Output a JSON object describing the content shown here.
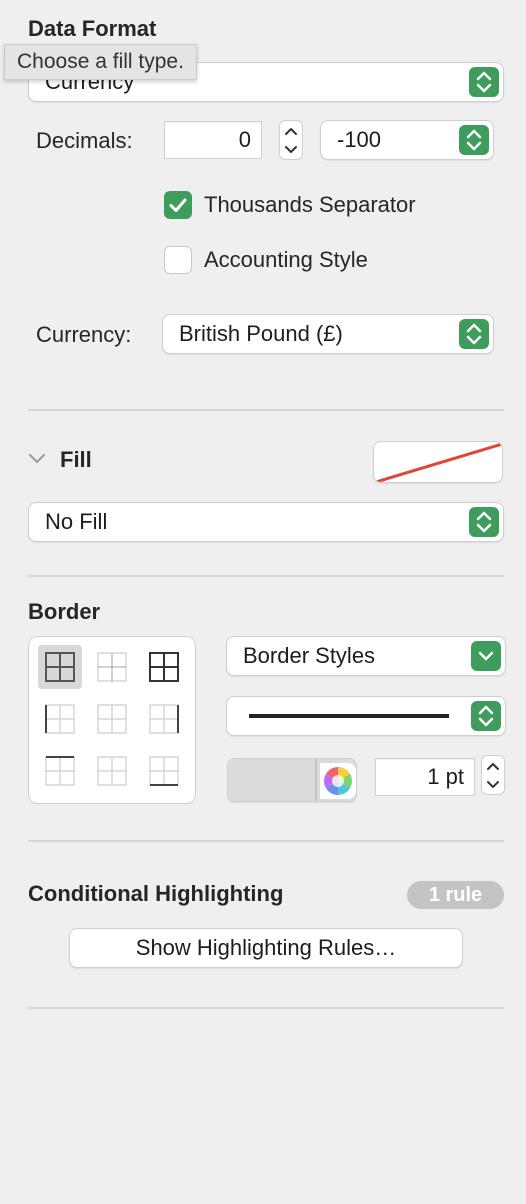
{
  "data_format": {
    "title": "Data Format",
    "format_value": "Currency",
    "decimals_label": "Decimals:",
    "decimals_value": "0",
    "negative_value": "-100",
    "thousands_label": "Thousands Separator",
    "thousands_checked": true,
    "accounting_label": "Accounting Style",
    "accounting_checked": false,
    "currency_label": "Currency:",
    "currency_value": "British Pound (£)"
  },
  "tooltip": {
    "text": "Choose a fill type."
  },
  "fill": {
    "title": "Fill",
    "fill_value": "No Fill"
  },
  "border": {
    "title": "Border",
    "styles_value": "Border Styles",
    "width_value": "1 pt"
  },
  "conditional": {
    "title": "Conditional Highlighting",
    "badge": "1 rule",
    "button_label": "Show Highlighting Rules…"
  },
  "colors": {
    "accent": "#3e9c5c",
    "background": "#efefef",
    "no_fill_line": "#e04535"
  }
}
